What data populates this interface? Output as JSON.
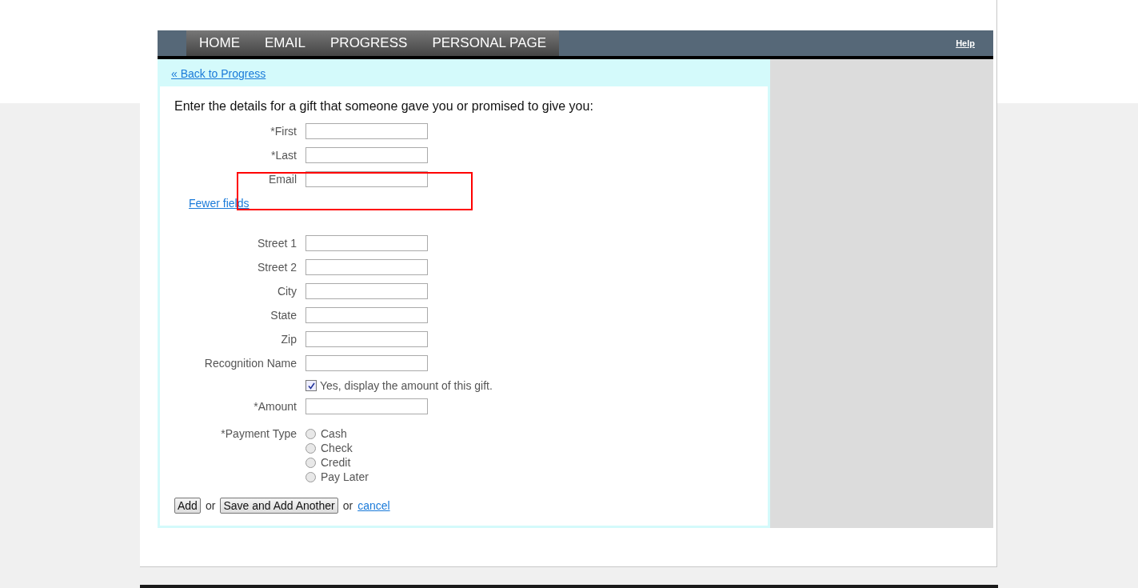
{
  "nav": {
    "items": [
      {
        "label": "HOME"
      },
      {
        "label": "EMAIL"
      },
      {
        "label": "PROGRESS"
      },
      {
        "label": "PERSONAL PAGE"
      }
    ],
    "help": "Help"
  },
  "back_link": "« Back to Progress",
  "intro": "Enter the details for a gift that someone gave you or promised to give you:",
  "rows": [
    {
      "kind": "input",
      "label": "*First"
    },
    {
      "kind": "input",
      "label": "*Last"
    },
    {
      "kind": "input",
      "label": "Email",
      "highlighted": true
    },
    {
      "kind": "link",
      "label": "Fewer fields"
    },
    {
      "kind": "input",
      "label": "Street 1"
    },
    {
      "kind": "input",
      "label": "Street 2"
    },
    {
      "kind": "input",
      "label": "City"
    },
    {
      "kind": "input",
      "label": "State"
    },
    {
      "kind": "input",
      "label": "Zip"
    },
    {
      "kind": "input",
      "label": "Recognition Name"
    },
    {
      "kind": "checkbox",
      "label": "Yes, display the amount of this gift.",
      "checked": true
    },
    {
      "kind": "input",
      "label": "*Amount"
    },
    {
      "kind": "radio",
      "label": "*Payment Type",
      "options": [
        {
          "label": "Cash",
          "selected": false
        },
        {
          "label": "Check",
          "selected": false
        },
        {
          "label": "Credit",
          "selected": false
        },
        {
          "label": "Pay Later",
          "selected": false
        }
      ]
    }
  ],
  "actions": {
    "add": "Add",
    "or_1": "or",
    "save_another": "Save and Add Another",
    "or_2": "or",
    "cancel": "cancel"
  }
}
